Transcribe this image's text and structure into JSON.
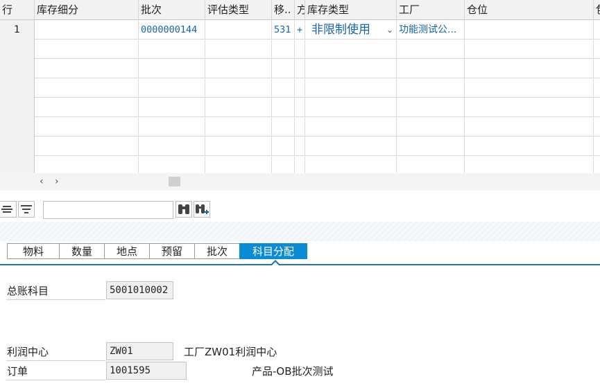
{
  "table": {
    "columns": [
      "行",
      "库存细分",
      "批次",
      "评估类型",
      "移..",
      "方",
      "库存类型",
      "工厂",
      "仓位",
      "包"
    ],
    "rows": [
      {
        "row_no": "1",
        "stock_breakdown": "",
        "batch": "0000000144",
        "valuation_type": "",
        "movement": "531",
        "direction": "+",
        "stock_type": "非限制使用",
        "plant": "功能测试公...",
        "bin": ""
      }
    ]
  },
  "scroll": {
    "left_icon": "chevron-left-icon",
    "right_icon": "chevron-right-icon"
  },
  "toolbar": {
    "search_value": "",
    "icons": [
      "align-center-icon",
      "filter-icon",
      "binoculars-icon",
      "binoculars-plus-icon"
    ]
  },
  "tabs": [
    {
      "label": "物料",
      "active": false
    },
    {
      "label": "数量",
      "active": false
    },
    {
      "label": "地点",
      "active": false
    },
    {
      "label": "预留",
      "active": false
    },
    {
      "label": "批次",
      "active": false
    },
    {
      "label": "科目分配",
      "active": true
    }
  ],
  "form": {
    "gl_account_label": "总账科目",
    "gl_account_value": "5001010002",
    "profit_center_label": "利润中心",
    "profit_center_value": "ZW01",
    "profit_center_desc": "工厂ZW01利润中心",
    "order_label": "订单",
    "order_value": "1001595",
    "order_desc": "产品-OB批次测试"
  },
  "colors": {
    "accent": "#0a8bd6",
    "link_blue": "#1565a8",
    "header_bg": "#f2f2f2"
  }
}
